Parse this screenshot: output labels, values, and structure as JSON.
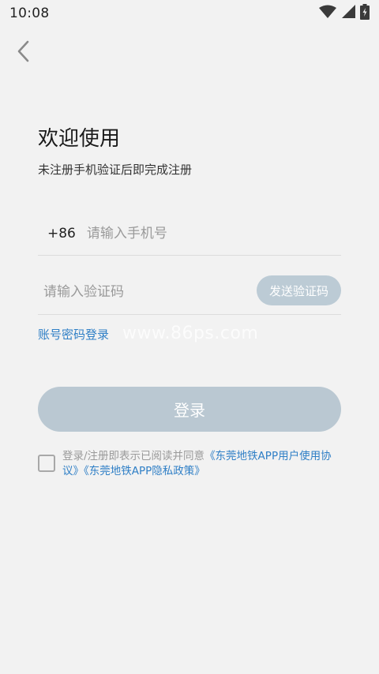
{
  "status_bar": {
    "time": "10:08",
    "icons": [
      "wifi-icon",
      "signal-icon",
      "battery-charging-icon"
    ]
  },
  "header": {
    "back_icon": "chevron-left-icon"
  },
  "main": {
    "title": "欢迎使用",
    "subtitle": "未注册手机验证后即完成注册",
    "phone": {
      "country_code": "+86",
      "placeholder": "请输入手机号",
      "value": ""
    },
    "verification": {
      "placeholder": "请输入验证码",
      "value": "",
      "send_button_label": "发送验证码"
    },
    "account_login_link": "账号密码登录",
    "watermark": "www.86ps.com",
    "login_button_label": "登录",
    "agreement": {
      "checked": false,
      "prefix": "登录/注册即表示已阅读并同意",
      "user_agreement": "《东莞地铁APP用户使用协议》",
      "privacy_policy": "《东莞地铁APP隐私政策》"
    }
  },
  "colors": {
    "background": "#f2f2f2",
    "link": "#2f7fc6",
    "button_disabled": "#bac8d2",
    "placeholder": "#9a9a9a"
  }
}
